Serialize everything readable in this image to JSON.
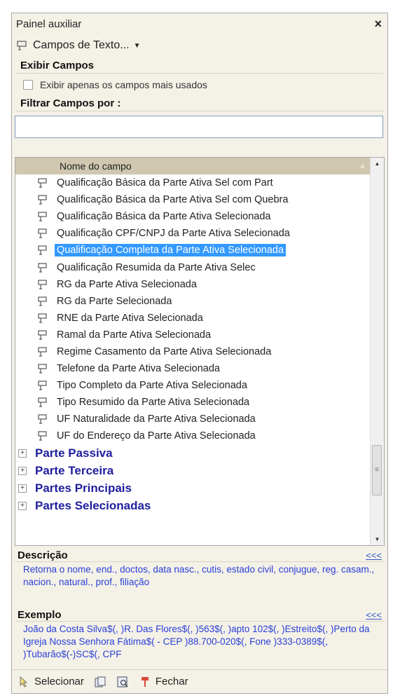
{
  "panel": {
    "title": "Painel auxiliar",
    "close_label": "×",
    "mode_dropdown": "Campos de Texto...",
    "exibir_section": "Exibir Campos",
    "checkbox_label": "Exibir apenas os campos mais usados",
    "filter_section": "Filtrar Campos por :",
    "filter_value": ""
  },
  "tree": {
    "column_header": "Nome do campo",
    "fields": [
      {
        "label": "Qualificação Básica da Parte Ativa Sel com Part"
      },
      {
        "label": "Qualificação Básica da Parte Ativa Sel com Quebra"
      },
      {
        "label": "Qualificação Básica da Parte Ativa Selecionada"
      },
      {
        "label": "Qualificação CPF/CNPJ da Parte Ativa Selecionada"
      },
      {
        "label": "Qualificação Completa da Parte Ativa Selecionada",
        "selected": true
      },
      {
        "label": "Qualificação Resumida da Parte Ativa Selec"
      },
      {
        "label": "RG da Parte Ativa Selecionada"
      },
      {
        "label": "RG da Parte Selecionada"
      },
      {
        "label": "RNE da Parte Ativa Selecionada"
      },
      {
        "label": "Ramal da Parte Ativa Selecionada"
      },
      {
        "label": "Regime Casamento da Parte Ativa Selecionada"
      },
      {
        "label": "Telefone da Parte Ativa Selecionada"
      },
      {
        "label": "Tipo Completo da Parte Ativa Selecionada"
      },
      {
        "label": "Tipo Resumido da Parte Ativa Selecionada"
      },
      {
        "label": "UF Naturalidade da Parte Ativa Selecionada"
      },
      {
        "label": "UF do Endereço da Parte Ativa Selecionada"
      }
    ],
    "groups": [
      {
        "label": "Parte Passiva"
      },
      {
        "label": "Parte Terceira"
      },
      {
        "label": "Partes Principais"
      },
      {
        "label": "Partes Selecionadas"
      }
    ]
  },
  "description": {
    "title": "Descrição",
    "collapse_link": "<<<",
    "text": "Retorna o nome, end., doctos, data nasc., cutis, estado civil, conjugue, reg. casam., nacion., natural., prof., filiação"
  },
  "example": {
    "title": "Exemplo",
    "collapse_link": "<<<",
    "text": "João da Costa Silva$(, )R. Das Flores$(, )563$(, )apto 102$(, )Estreito$(, )Perto da Igreja Nossa Senhora Fátima$( - CEP )88.700-020$(, Fone )333-0389$(, )Tubarão$(-)SC$(, CPF"
  },
  "toolbar": {
    "select_label": "Selecionar",
    "close_label": "Fechar"
  },
  "colors": {
    "selection": "#3399ff",
    "group_text": "#1e1e9e",
    "link_text": "#2a3fd8"
  }
}
